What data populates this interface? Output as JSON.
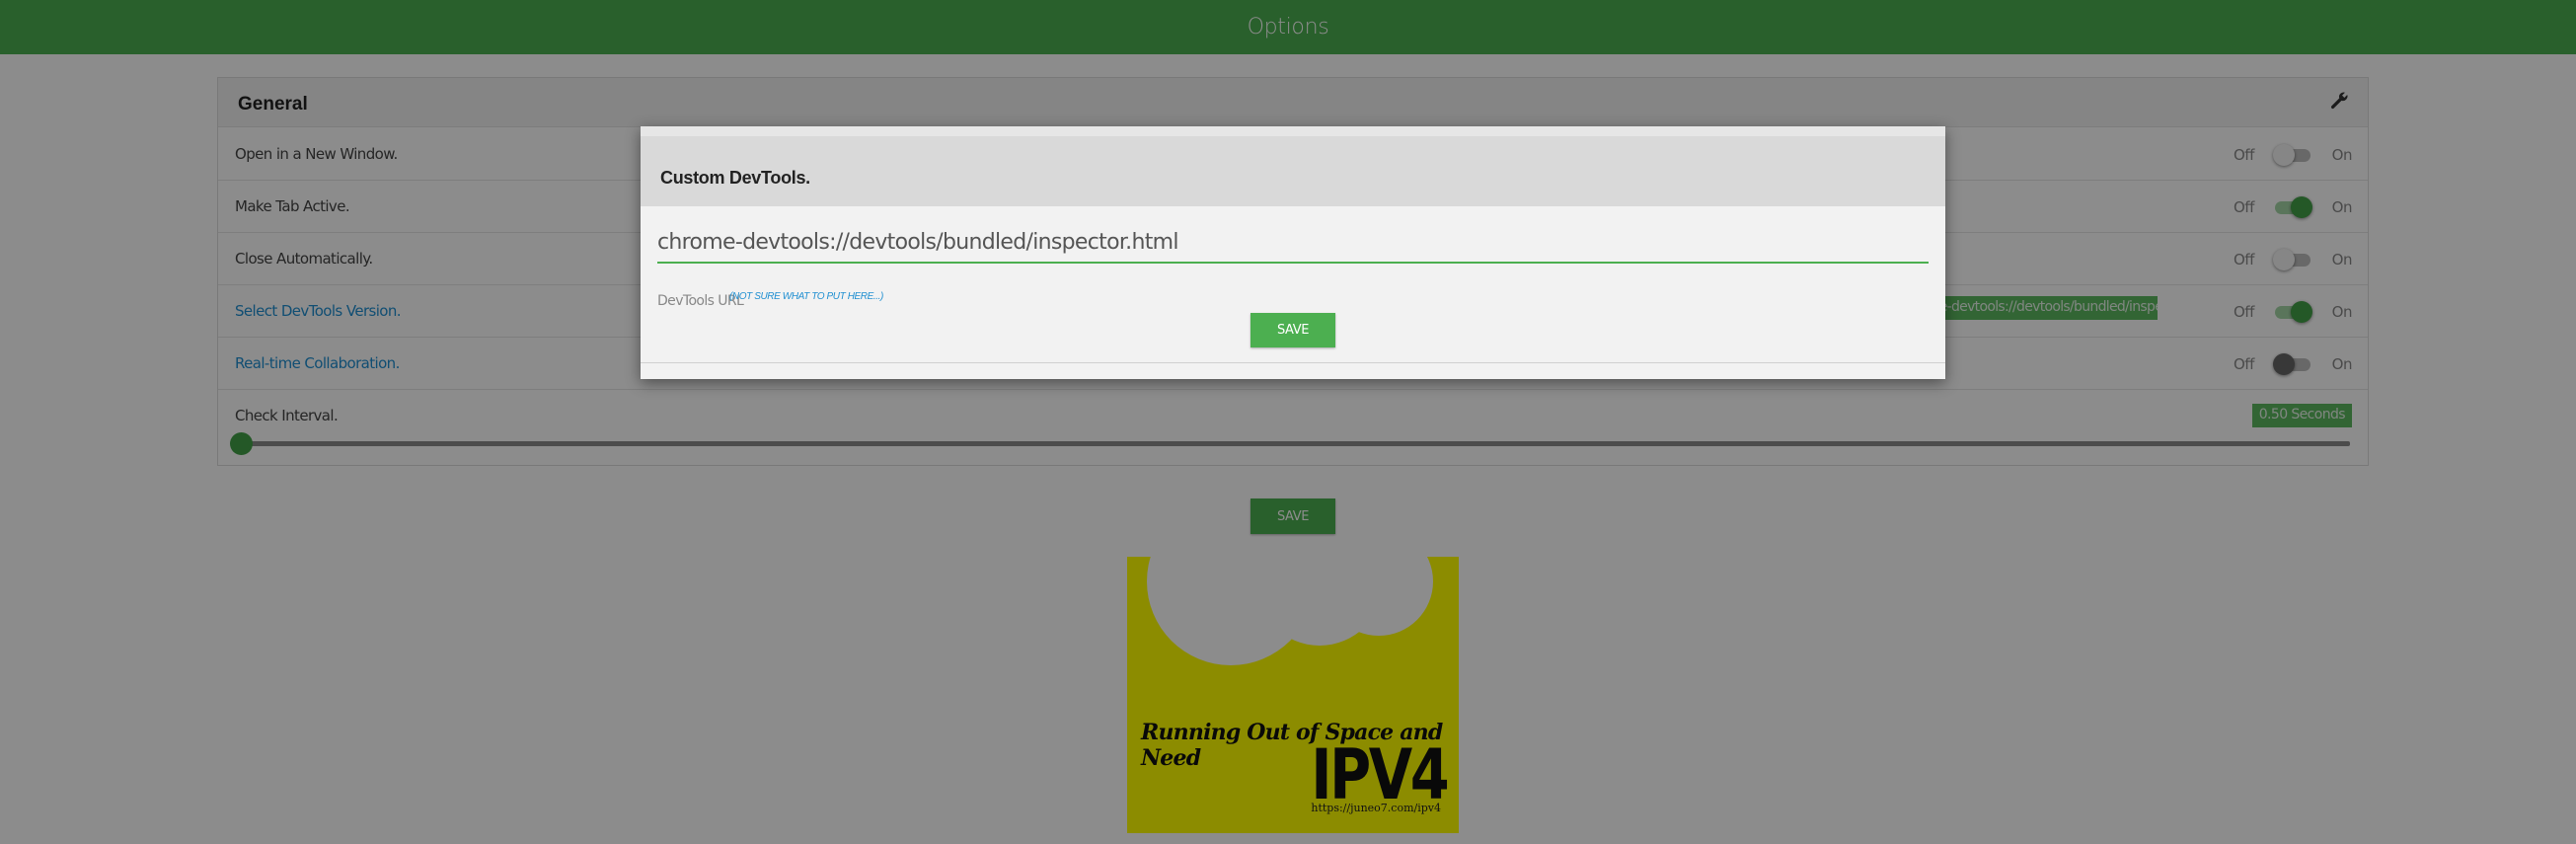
{
  "header": {
    "title": "Options"
  },
  "general": {
    "title": "General",
    "icon": "wrench-icon",
    "rows": [
      {
        "label": "Open in a New Window.",
        "off": "Off",
        "on": "On",
        "state": "off"
      },
      {
        "label": "Make Tab Active.",
        "off": "Off",
        "on": "On",
        "state": "on"
      },
      {
        "label": "Close Automatically.",
        "off": "Off",
        "on": "On",
        "state": "off"
      },
      {
        "label": "Select DevTools Version.",
        "off": "Off",
        "on": "On",
        "state": "on",
        "value": "chrome-devtools://devtools/bundled/inspector.html"
      },
      {
        "label": "Real-time Collaboration.",
        "off": "Off",
        "on": "On",
        "state": "off"
      }
    ],
    "interval": {
      "label": "Check Interval.",
      "value": "0.50 Seconds",
      "fraction": 0.0
    }
  },
  "page_save": {
    "label": "SAVE"
  },
  "ad": {
    "tagline": "Running Out of Space and Need",
    "headline": "IPV4",
    "url": "https://juneo7.com/ipv4"
  },
  "modal": {
    "title": "Custom DevTools.",
    "input_value": "chrome-devtools://devtools/bundled/inspector.html",
    "help_label": "DevTools URL",
    "help_link": "(NOT SURE WHAT TO PUT HERE...)",
    "save_label": "SAVE"
  },
  "colors": {
    "accent": "#4caf50",
    "link": "#1f8fd1"
  }
}
